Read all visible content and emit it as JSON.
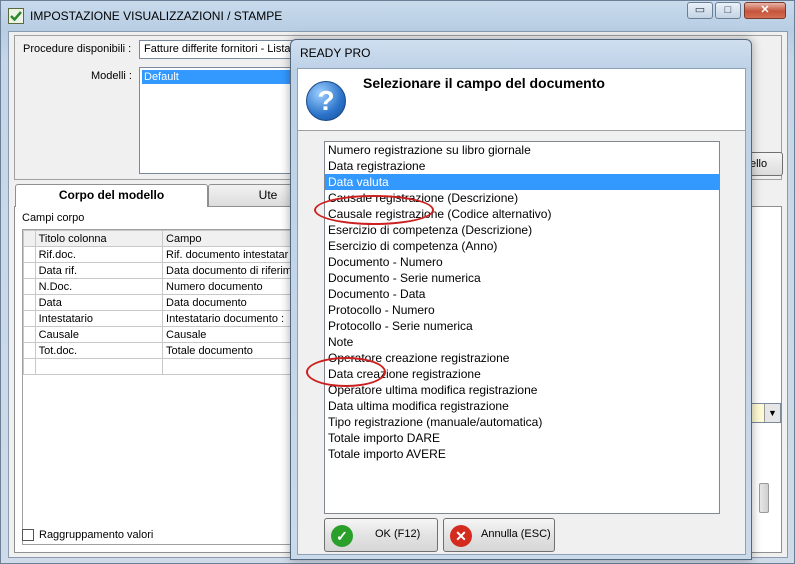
{
  "main_window": {
    "title": "IMPOSTAZIONE VISUALIZZAZIONI / STAMPE",
    "controls": {
      "minimize": "▭",
      "maximize": "□",
      "close": "✕"
    },
    "procedure_label": "Procedure disponibili :",
    "procedure_value": "Fatture differite fornitori - Lista doc",
    "models_label": "Modelli :",
    "models": [
      "Default"
    ],
    "side_button_label": "ello",
    "tabs": [
      "Corpo del modello",
      "Ute"
    ],
    "grid_caption": "Campi corpo",
    "grid_headers": [
      "Titolo colonna",
      "Campo"
    ],
    "grid_rows": [
      {
        "title": "Rif.doc.",
        "field": "Rif. documento intestatar"
      },
      {
        "title": "Data rif.",
        "field": "Data documento di riferim"
      },
      {
        "title": "N.Doc.",
        "field": "Numero documento"
      },
      {
        "title": "Data",
        "field": "Data documento"
      },
      {
        "title": "Intestatario",
        "field": "Intestatario documento :"
      },
      {
        "title": "Causale",
        "field": "Causale"
      },
      {
        "title": "Tot.doc.",
        "field": "Totale documento"
      }
    ],
    "grouping_label": "Raggruppamento valori"
  },
  "dialog": {
    "title": "READY PRO",
    "heading": "Selezionare il campo del documento",
    "fields": [
      "Numero registrazione su libro giornale",
      "Data registrazione",
      "Data valuta",
      "Causale registrazione (Descrizione)",
      "Causale registrazione (Codice alternativo)",
      "Esercizio di competenza (Descrizione)",
      "Esercizio di competenza (Anno)",
      "Documento - Numero",
      "Documento - Serie numerica",
      "Documento - Data",
      "Protocollo - Numero",
      "Protocollo - Serie numerica",
      "Note",
      "Operatore creazione registrazione",
      "Data creazione registrazione",
      "Operatore ultima modifica registrazione",
      "Data ultima modifica registrazione",
      "Tipo registrazione (manuale/automatica)",
      "Totale importo DARE",
      "Totale importo AVERE"
    ],
    "selected_field": "Data valuta",
    "ok_label": "OK (F12)",
    "cancel_label": "Annulla (ESC)"
  },
  "colors": {
    "selection": "#3399ff",
    "annotation": "#cc2020",
    "ok_icon": "#2aa02a",
    "cancel_icon": "#d52b1e"
  },
  "icons": [
    "checkbox-checked-icon",
    "question-icon",
    "checkmark-icon",
    "cancel-icon",
    "dropdown-arrow-icon"
  ]
}
